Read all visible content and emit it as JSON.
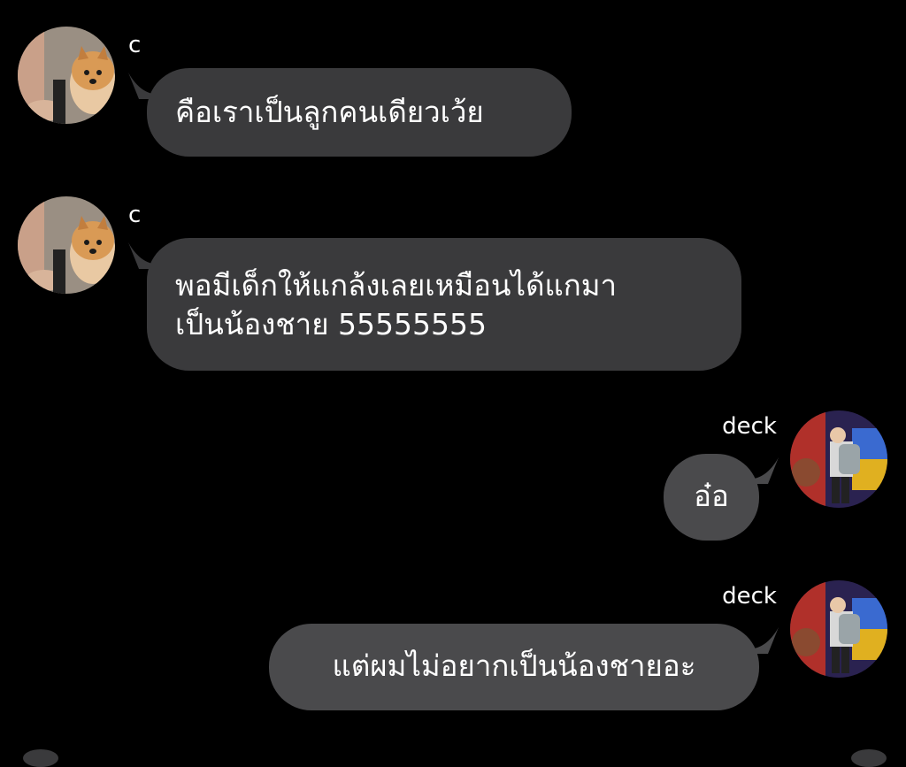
{
  "messages": [
    {
      "sender": "c",
      "text": "คือเราเป็นลูกคนเดียวเว้ย",
      "avatar_icon": "pomeranian-dog-avatar"
    },
    {
      "sender": "c",
      "text": "พอมีเด็กให้แกล้งเลยเหมือนได้แกมา\nเป็นน้องชาย 55555555",
      "avatar_icon": "pomeranian-dog-avatar"
    },
    {
      "sender": "deck",
      "text": "อ๋อ",
      "avatar_icon": "arcade-person-avatar"
    },
    {
      "sender": "deck",
      "text": "แต่ผมไม่อยากเป็นน้องชายอะ",
      "avatar_icon": "arcade-person-avatar"
    }
  ],
  "colors": {
    "background": "#000000",
    "incoming_bubble": "#3a3a3c",
    "outgoing_bubble": "#4a4a4c",
    "text": "#ffffff"
  }
}
